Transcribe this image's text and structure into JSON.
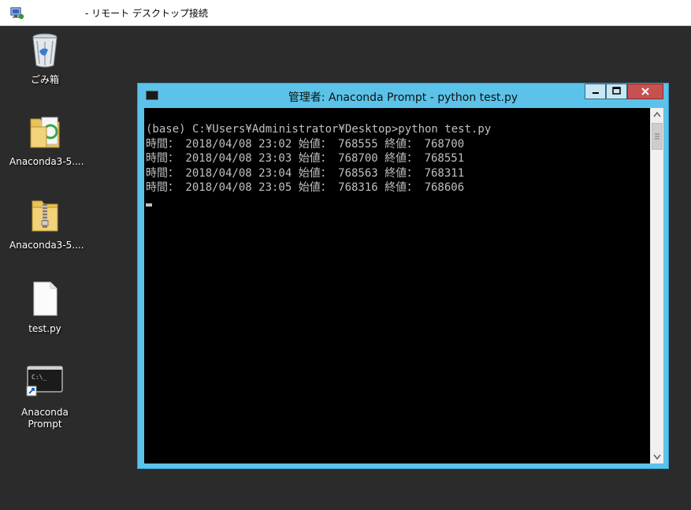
{
  "rdp": {
    "title": "- リモート デスクトップ接続"
  },
  "desktop": {
    "icons": [
      {
        "label": "ごみ箱",
        "icon": "recycle-bin-icon"
      },
      {
        "label": "Anaconda3-5....",
        "icon": "folder-icon"
      },
      {
        "label": "Anaconda3-5....",
        "icon": "zip-folder-icon"
      },
      {
        "label": "test.py",
        "icon": "file-icon"
      },
      {
        "label": "Anaconda\nPrompt",
        "icon": "console-shortcut-icon"
      }
    ]
  },
  "console": {
    "title": "管理者: Anaconda Prompt - python  test.py",
    "buttons": {
      "minimize": "minimize-icon",
      "maximize": "maximize-icon",
      "close": "close-icon"
    },
    "lines": [
      "(base) C:¥Users¥Administrator¥Desktop>python test.py",
      "時間： 2018/04/08 23:02 始値： 768555 終値： 768700",
      "時間： 2018/04/08 23:03 始値： 768700 終値： 768551",
      "時間： 2018/04/08 23:04 始値： 768563 終値： 768311",
      "時間： 2018/04/08 23:05 始値： 768316 終値： 768606"
    ]
  },
  "colors": {
    "console_frame": "#5bc3e9",
    "close_button": "#c75050",
    "desktop": "#2b2b2b"
  }
}
